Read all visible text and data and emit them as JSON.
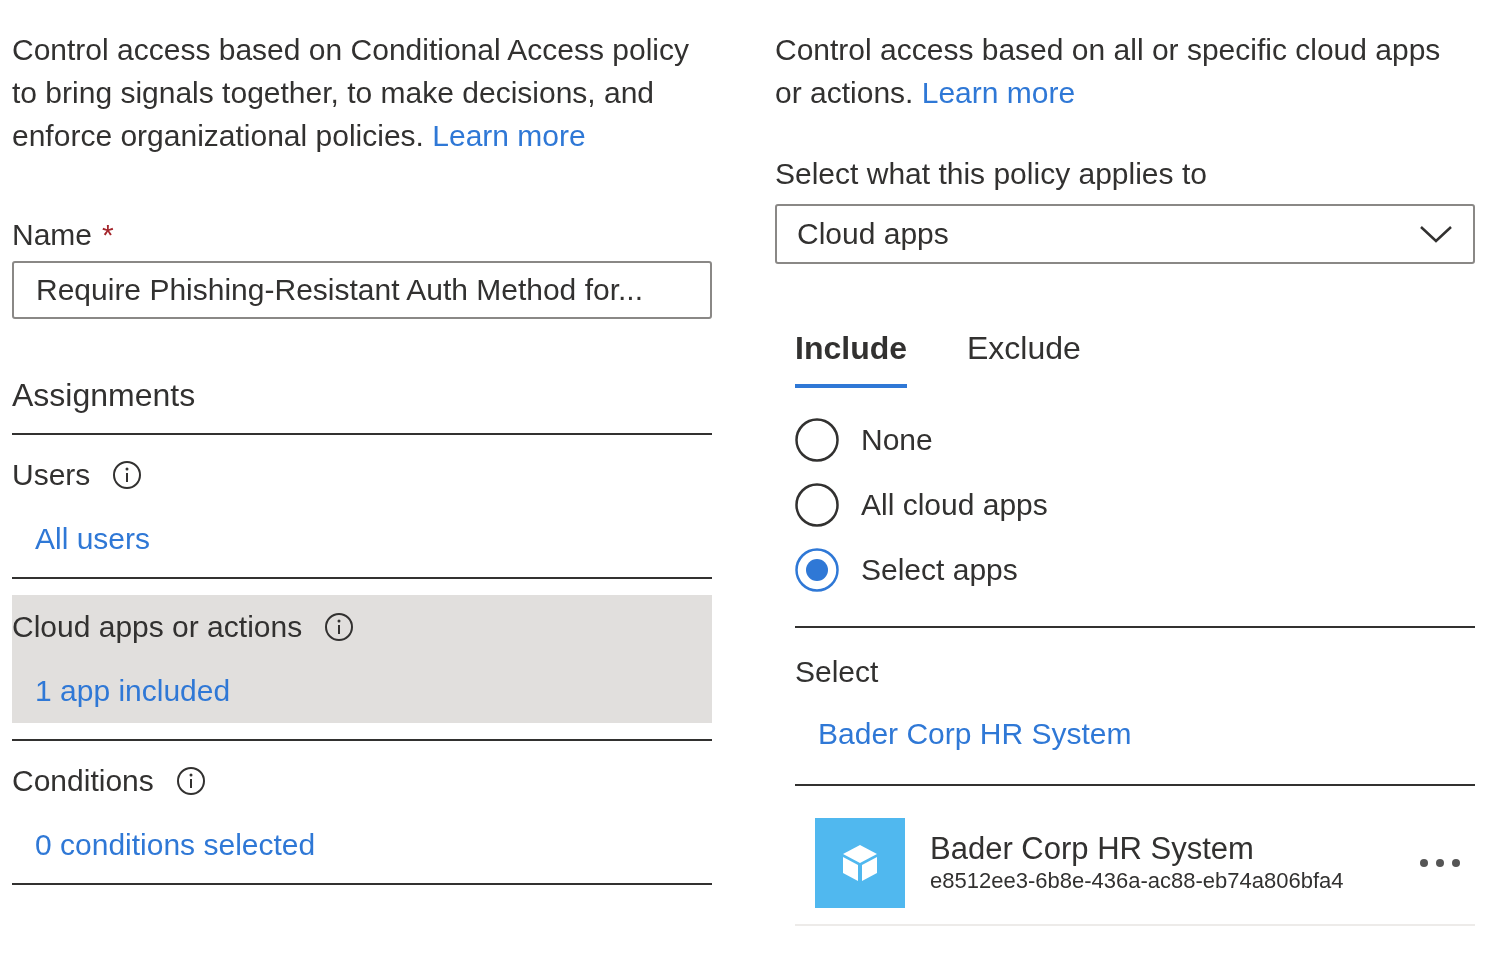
{
  "left": {
    "description": "Control access based on Conditional Access policy to bring signals together, to make decisions, and enforce organizational policies.",
    "learn_more": "Learn more",
    "name_field": {
      "label": "Name",
      "required_mark": "*",
      "value": "Require Phishing-Resistant Auth Method for..."
    },
    "assignments_heading": "Assignments",
    "sections": [
      {
        "title": "Users",
        "value": "All users",
        "selected": false
      },
      {
        "title": "Cloud apps or actions",
        "value": "1 app included",
        "selected": true
      },
      {
        "title": "Conditions",
        "value": "0 conditions selected",
        "selected": false
      }
    ]
  },
  "right": {
    "description": "Control access based on all or specific cloud apps or actions.",
    "learn_more": "Learn more",
    "applies_to": {
      "label": "Select what this policy applies to",
      "value": "Cloud apps"
    },
    "tabs": [
      {
        "label": "Include",
        "selected": true
      },
      {
        "label": "Exclude",
        "selected": false
      }
    ],
    "options": [
      {
        "label": "None",
        "selected": false
      },
      {
        "label": "All cloud apps",
        "selected": false
      },
      {
        "label": "Select apps",
        "selected": true
      }
    ],
    "select_heading": "Select",
    "select_link": "Bader Corp HR System",
    "apps": [
      {
        "name": "Bader Corp HR System",
        "id": "e8512ee3-6b8e-436a-ac88-eb74a806bfa4"
      }
    ]
  }
}
